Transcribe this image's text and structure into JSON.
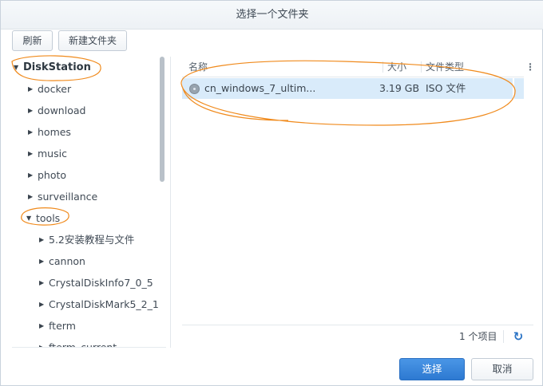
{
  "dialog": {
    "title": "选择一个文件夹"
  },
  "toolbar": {
    "refresh_label": "刷新",
    "new_folder_label": "新建文件夹"
  },
  "tree": {
    "root": "DiskStation",
    "items": [
      {
        "label": "docker",
        "expanded": false
      },
      {
        "label": "download",
        "expanded": false
      },
      {
        "label": "homes",
        "expanded": false
      },
      {
        "label": "music",
        "expanded": false
      },
      {
        "label": "photo",
        "expanded": false
      },
      {
        "label": "surveillance",
        "expanded": false
      },
      {
        "label": "tools",
        "expanded": true
      }
    ],
    "tools_children": [
      {
        "label": "5.2安装教程与文件"
      },
      {
        "label": "cannon"
      },
      {
        "label": "CrystalDiskInfo7_0_5"
      },
      {
        "label": "CrystalDiskMark5_2_1"
      },
      {
        "label": "fterm"
      },
      {
        "label": "fterm_current"
      }
    ]
  },
  "filelist": {
    "columns": {
      "name": "名称",
      "size": "大小",
      "type": "文件类型"
    },
    "menu_icon": "vertical-ellipsis",
    "rows": [
      {
        "name": "cn_windows_7_ultim...",
        "size": "3.19 GB",
        "type": "ISO 文件",
        "icon": "disc-image-icon"
      }
    ],
    "item_count": "1 个项目",
    "refresh_icon": "refresh-icon"
  },
  "buttons": {
    "select_label": "选择",
    "cancel_label": "取消"
  },
  "colors": {
    "accent": "#2d79d1",
    "selected_row": "#d9ebfa",
    "annotation": "#f08a1c"
  }
}
